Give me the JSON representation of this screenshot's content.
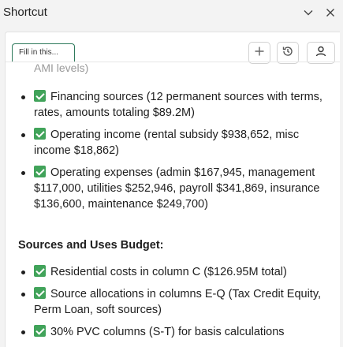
{
  "app": {
    "title": "Shortcut"
  },
  "titlebar_icons": [
    "chevron-down-icon",
    "close-icon"
  ],
  "toolbar": {
    "fill_label": "Fill in this...",
    "buttons": [
      "plus-icon",
      "history-icon",
      "user-icon"
    ]
  },
  "content": {
    "cut_text": "AMI levels)",
    "list1": [
      "Financing sources (12 permanent sources with terms, rates, amounts totaling $89.2M)",
      "Operating income (rental subsidy $938,652, misc income $18,862)",
      "Operating expenses (admin $167,945, management $117,000, utilities $252,946, payroll $341,869, insurance $136,600, maintenance $249,700)"
    ],
    "heading": "Sources and Uses Budget:",
    "list2": [
      "Residential costs in column C ($126.95M total)",
      "Source allocations in columns E-Q (Tax Credit Equity, Perm Loan, soft sources)",
      "30% PVC columns (S-T) for basis calculations"
    ]
  },
  "colors": {
    "check": "#41a35a",
    "accent_border": "#2f7a5c"
  }
}
